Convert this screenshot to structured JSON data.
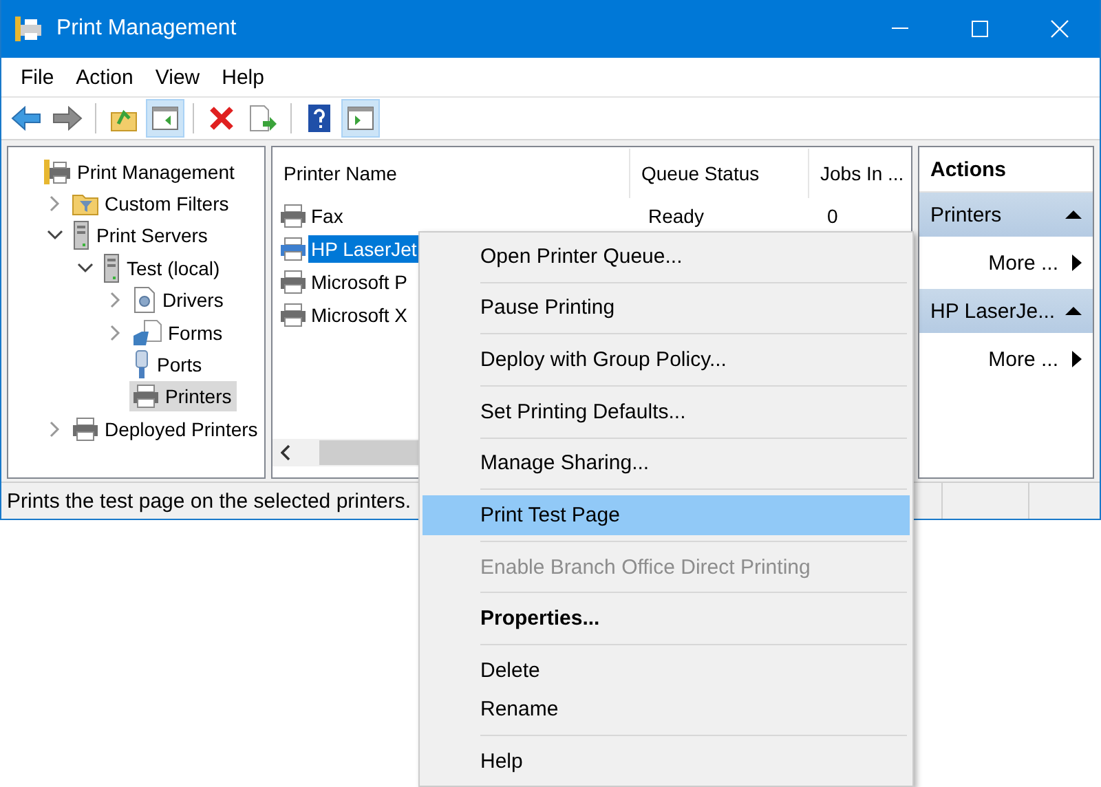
{
  "window": {
    "title": "Print Management"
  },
  "menu_bar": [
    "File",
    "Action",
    "View",
    "Help"
  ],
  "toolbar": [
    {
      "kind": "back",
      "pressed": false
    },
    {
      "kind": "forward",
      "pressed": false
    },
    {
      "kind": "separator"
    },
    {
      "kind": "up",
      "pressed": false
    },
    {
      "kind": "tree",
      "pressed": true
    },
    {
      "kind": "separator"
    },
    {
      "kind": "delete",
      "pressed": false
    },
    {
      "kind": "export",
      "pressed": false
    },
    {
      "kind": "separator"
    },
    {
      "kind": "help",
      "pressed": false
    },
    {
      "kind": "actions",
      "pressed": true
    }
  ],
  "tree": [
    {
      "label": "Print Management",
      "kind": "root",
      "selected": false,
      "children": [
        {
          "label": "Custom Filters",
          "kind": "filter",
          "selected": false,
          "expanded": false
        },
        {
          "label": "Print Servers",
          "kind": "server",
          "selected": false,
          "expanded": true,
          "children": [
            {
              "label": "Test (local)",
              "kind": "server",
              "selected": false,
              "expanded": true,
              "children": [
                {
                  "label": "Drivers",
                  "kind": "drivers",
                  "selected": false,
                  "expanded": false
                },
                {
                  "label": "Forms",
                  "kind": "forms",
                  "selected": false,
                  "expanded": false
                },
                {
                  "label": "Ports",
                  "kind": "ports",
                  "selected": false
                },
                {
                  "label": "Printers",
                  "kind": "printer",
                  "selected": true
                }
              ]
            }
          ]
        },
        {
          "label": "Deployed Printers",
          "kind": "printer",
          "selected": false,
          "expanded": false
        }
      ]
    }
  ],
  "table": {
    "columns": [
      "Printer Name",
      "Queue Status",
      "Jobs In ..."
    ],
    "rows": [
      {
        "cells": [
          "Fax",
          "Ready",
          "0"
        ],
        "selected": false
      },
      {
        "cells": [
          "HP LaserJet"
        ],
        "selected": true
      },
      {
        "cells": [
          "Microsoft P"
        ],
        "selected": false
      },
      {
        "cells": [
          "Microsoft X"
        ],
        "selected": false
      }
    ]
  },
  "actions": {
    "title": "Actions",
    "sections": [
      {
        "title": "Printers",
        "expanded": true,
        "items": [
          "More ..."
        ]
      },
      {
        "title": "HP LaserJe...",
        "expanded": true,
        "items": [
          "More ..."
        ]
      }
    ]
  },
  "status_bar": "Prints the test page on the selected printers.",
  "context_menu": {
    "groups": [
      [
        {
          "label": "Open Printer Queue...",
          "selected": false,
          "disabled": false,
          "default": false
        }
      ],
      [
        {
          "label": "Pause Printing",
          "selected": false,
          "disabled": false,
          "default": false
        }
      ],
      [
        {
          "label": "Deploy with Group Policy...",
          "selected": false,
          "disabled": false,
          "default": false
        }
      ],
      [
        {
          "label": "Set Printing Defaults...",
          "selected": false,
          "disabled": false,
          "default": false
        }
      ],
      [
        {
          "label": "Manage Sharing...",
          "selected": false,
          "disabled": false,
          "default": false
        }
      ],
      [
        {
          "label": "Print Test Page",
          "selected": true,
          "disabled": false,
          "default": false
        }
      ],
      [
        {
          "label": "Enable Branch Office Direct Printing",
          "selected": false,
          "disabled": true,
          "default": false
        }
      ],
      [
        {
          "label": "Properties...",
          "selected": false,
          "disabled": false,
          "default": true
        }
      ],
      [
        {
          "label": "Delete",
          "selected": false,
          "disabled": false,
          "default": false
        },
        {
          "label": "Rename",
          "selected": false,
          "disabled": false,
          "default": false
        }
      ],
      [
        {
          "label": "Help",
          "selected": false,
          "disabled": false,
          "default": false
        }
      ]
    ]
  }
}
